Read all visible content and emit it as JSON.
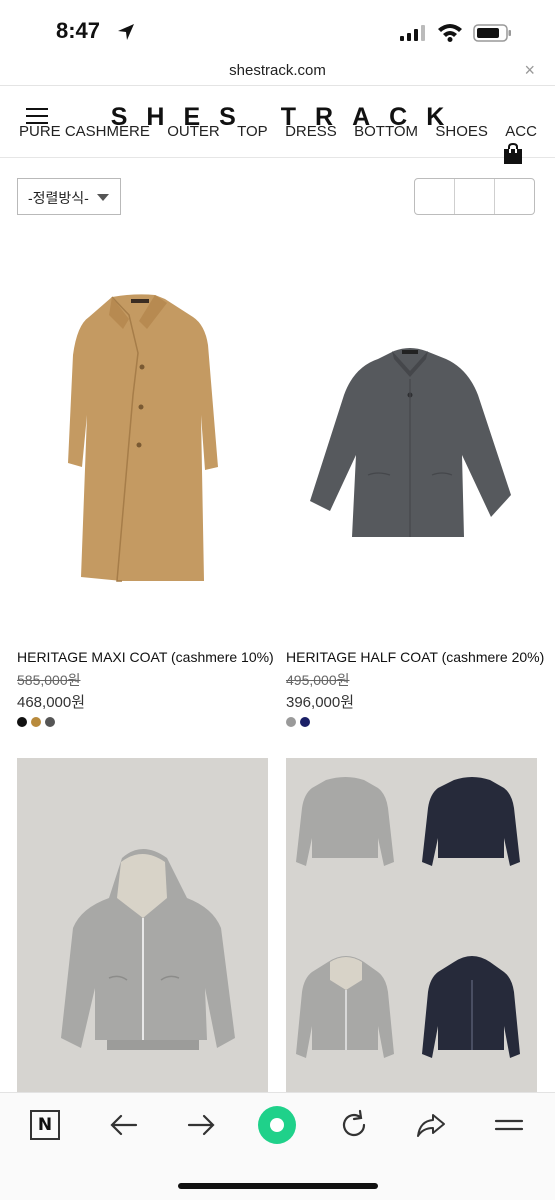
{
  "status_bar": {
    "time": "8:47"
  },
  "browser": {
    "url": "shestrack.com",
    "close_label": "×"
  },
  "site": {
    "logo": "SHES TRACK",
    "nav": [
      "PURE CASHMERE",
      "OUTER",
      "TOP",
      "DRESS",
      "BOTTOM",
      "SHOES",
      "ACC"
    ]
  },
  "sort": {
    "label": "-정렬방식-"
  },
  "products": [
    {
      "name": "HERITAGE MAXI COAT (cashmere 10%)",
      "original_price": "585,000원",
      "price": "468,000원",
      "swatches": [
        "#111111",
        "#b88a3c",
        "#555555"
      ]
    },
    {
      "name": "HERITAGE HALF COAT (cashmere 20%)",
      "original_price": "495,000원",
      "price": "396,000원",
      "swatches": [
        "#9a9a9a",
        "#1a1f66"
      ]
    }
  ],
  "toolbar": {
    "n_label": "N"
  },
  "colors": {
    "coat_camel": "#c49a62",
    "coat_gray": "#56595d",
    "hoodie_gray": "#a8a8a6",
    "sweat_navy": "#262a3a",
    "toolbar_accent": "#1fd18a"
  }
}
